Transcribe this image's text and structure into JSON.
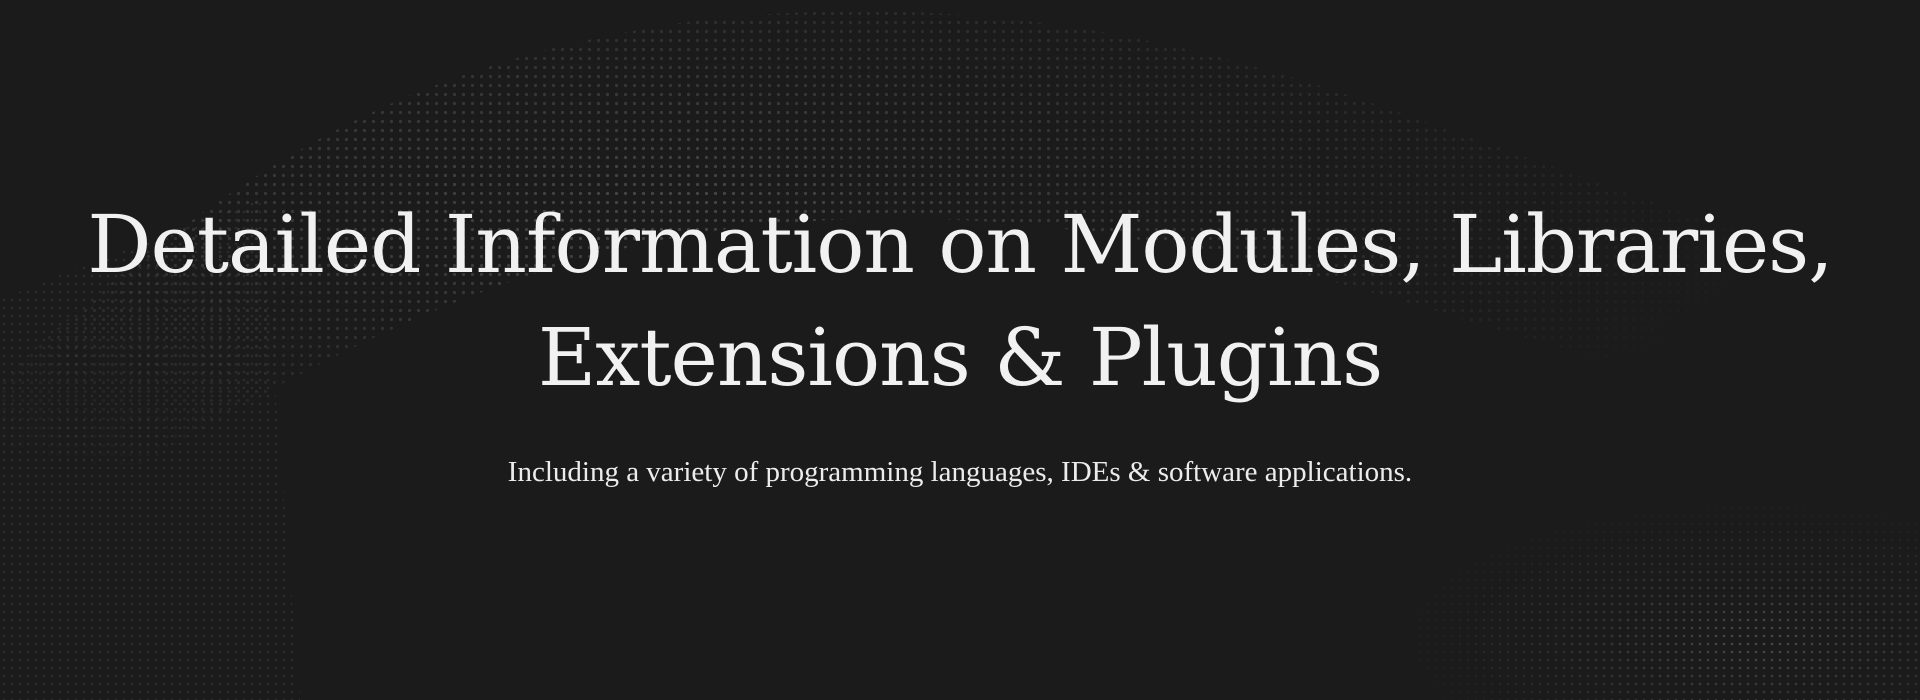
{
  "hero": {
    "title_line_1": "Detailed Information on Modules, Libraries,",
    "title_line_2": "Extensions & Plugins",
    "subtitle": "Including a variety of programming languages, IDEs & software applications."
  },
  "colors": {
    "background": "#1b1b1c",
    "title_text": "#f1f1f1",
    "subtitle_text": "#ececec",
    "dot_color": "#5a5a5a"
  }
}
